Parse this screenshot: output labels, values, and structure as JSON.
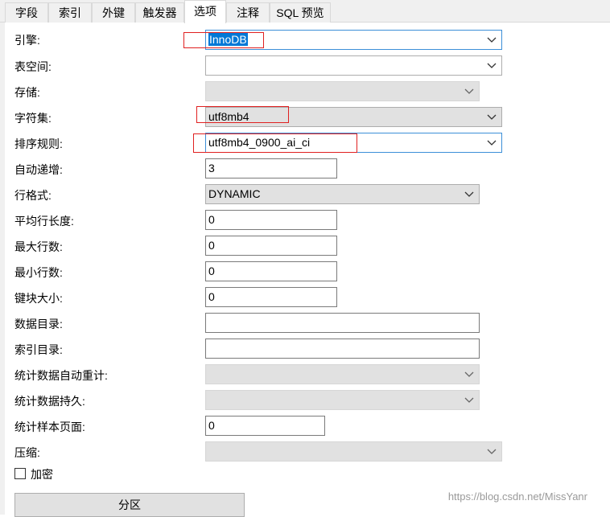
{
  "tabs": [
    {
      "label": "字段"
    },
    {
      "label": "索引"
    },
    {
      "label": "外键"
    },
    {
      "label": "触发器"
    },
    {
      "label": "选项",
      "active": true
    },
    {
      "label": "注释"
    },
    {
      "label": "SQL 预览"
    }
  ],
  "form": {
    "engine": {
      "label": "引擎:",
      "value": "InnoDB"
    },
    "tablespace": {
      "label": "表空间:",
      "value": ""
    },
    "storage": {
      "label": "存储:",
      "value": ""
    },
    "charset": {
      "label": "字符集:",
      "value": "utf8mb4"
    },
    "collation": {
      "label": "排序规则:",
      "value": "utf8mb4_0900_ai_ci"
    },
    "auto_increment": {
      "label": "自动递增:",
      "value": "3"
    },
    "row_format": {
      "label": "行格式:",
      "value": "DYNAMIC"
    },
    "avg_row_length": {
      "label": "平均行长度:",
      "value": "0"
    },
    "max_rows": {
      "label": "最大行数:",
      "value": "0"
    },
    "min_rows": {
      "label": "最小行数:",
      "value": "0"
    },
    "key_block_size": {
      "label": "键块大小:",
      "value": "0"
    },
    "data_directory": {
      "label": "数据目录:",
      "value": ""
    },
    "index_directory": {
      "label": "索引目录:",
      "value": ""
    },
    "stats_auto_recalc": {
      "label": "统计数据自动重计:",
      "value": ""
    },
    "stats_persistent": {
      "label": "统计数据持久:",
      "value": ""
    },
    "stats_sample_pages": {
      "label": "统计样本页面:",
      "value": "0"
    },
    "compression": {
      "label": "压缩:",
      "value": ""
    },
    "encryption": {
      "label": "加密",
      "checked": false
    }
  },
  "partition_button": "分区",
  "watermark": "https://blog.csdn.net/MissYanr",
  "colors": {
    "selection": "#0078d7",
    "annotation": "#e02020",
    "focus_border": "#3c8fd8"
  },
  "icons": {
    "combo_arrow": "chevron-down-icon",
    "checkbox": "checkbox-icon"
  }
}
